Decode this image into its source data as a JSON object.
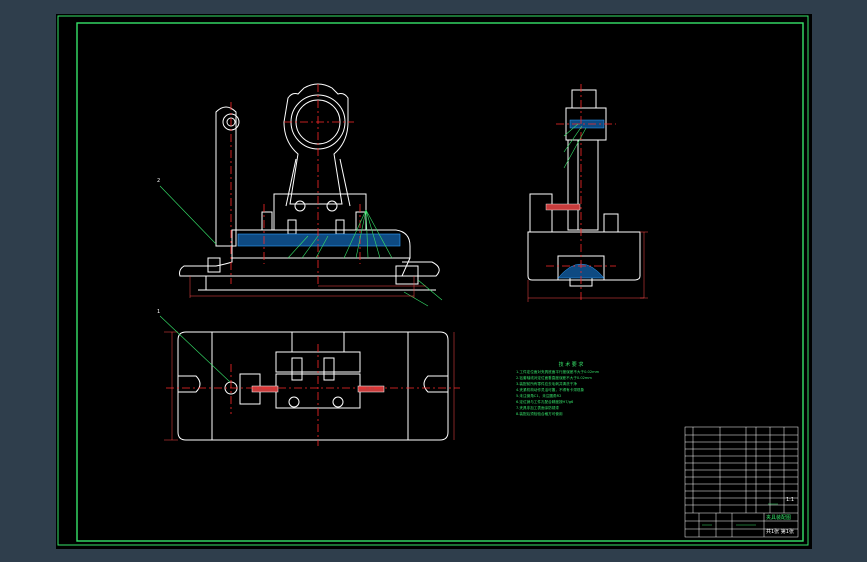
{
  "colors": {
    "background": "#2f3e4c",
    "sheet": "#000000",
    "border": "#36e36a",
    "outline": "#ffffff",
    "centerline": "#ff2a2a",
    "dimension": "#ff4b4b",
    "hatch": "#2fa0ff",
    "leader": "#36e36a",
    "callout_text": "#ff4b4b"
  },
  "views": {
    "front": {
      "part_label": "2"
    },
    "top": {
      "part_label": "1"
    }
  },
  "notes": {
    "title": "技 术 要 求",
    "lines": [
      "1.工件定位面对夹具底面平行度误差不大于0.02mm",
      "2.钻套轴线对定位面垂直度误差不大于0.02mm",
      "3.装配前所有零件应去毛刺并清洗干净",
      "4.夹紧机构动作灵活可靠，不得有卡滞现象",
      "5.未注倒角C1，未注圆角R2",
      "6.定位销与工件孔配合精度按H7/g6",
      "7.夹具非加工表面涂防锈漆",
      "8.装配后须检验合格方可使用"
    ]
  },
  "title_block": {
    "drawing_title": "夹具装配图",
    "scale": "1:1",
    "sheet": "共1张 第1张"
  }
}
